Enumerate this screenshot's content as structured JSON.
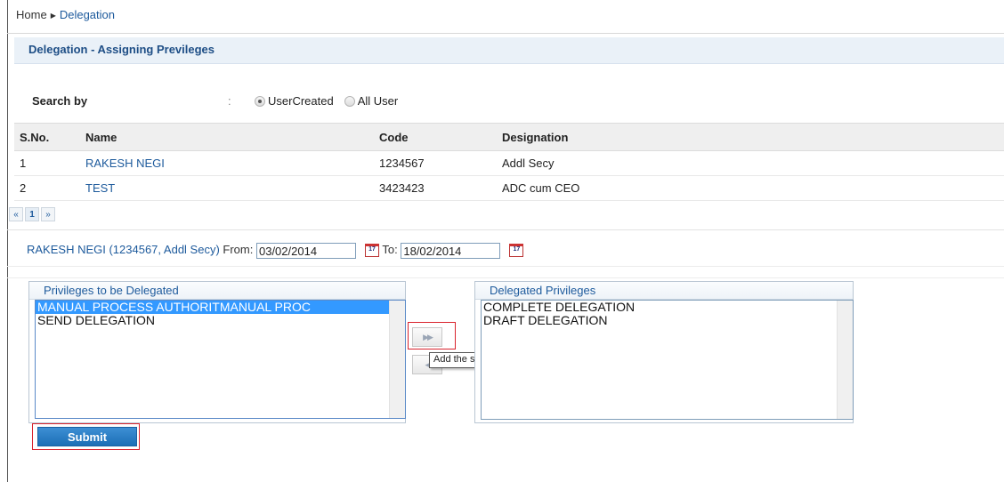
{
  "breadcrumb": {
    "home": "Home",
    "separator": "▶",
    "current": "Delegation"
  },
  "section_title": "Delegation - Assigning Previleges",
  "search": {
    "label": "Search by",
    "colon": ":",
    "options": [
      {
        "label": "UserCreated",
        "checked": true
      },
      {
        "label": "All User",
        "checked": false
      }
    ]
  },
  "table": {
    "headers": [
      "S.No.",
      "Name",
      "Code",
      "Designation"
    ],
    "rows": [
      {
        "sno": "1",
        "name": "RAKESH NEGI",
        "code": "1234567",
        "designation": "Addl Secy"
      },
      {
        "sno": "2",
        "name": "TEST",
        "code": "3423423",
        "designation": "ADC cum CEO"
      }
    ]
  },
  "pager": {
    "first": "«",
    "page": "1",
    "last": "»"
  },
  "range": {
    "user": "RAKESH NEGI (1234567, Addl Secy)",
    "from_label": "From:",
    "from_value": "03/02/2014",
    "to_label": "To:",
    "to_value": "18/02/2014",
    "calendar_day": "17"
  },
  "left_panel": {
    "title": "Privileges to be Delegated",
    "items": [
      "MANUAL PROCESS AUTHORITMANUAL PROC",
      "SEND DELEGATION"
    ],
    "selected_index": 0
  },
  "right_panel": {
    "title": "Delegated Privileges",
    "items": [
      "COMPLETE DELEGATION",
      "DRAFT DELEGATION"
    ]
  },
  "move_buttons": {
    "add": "▶▶",
    "remove": "◀"
  },
  "tooltip": "Add the selected privilege.",
  "submit_label": "Submit",
  "colors": {
    "link": "#1d5a9c",
    "selection": "#3399ff",
    "highlight": "#d9232d",
    "button": "#1c6fb6"
  }
}
